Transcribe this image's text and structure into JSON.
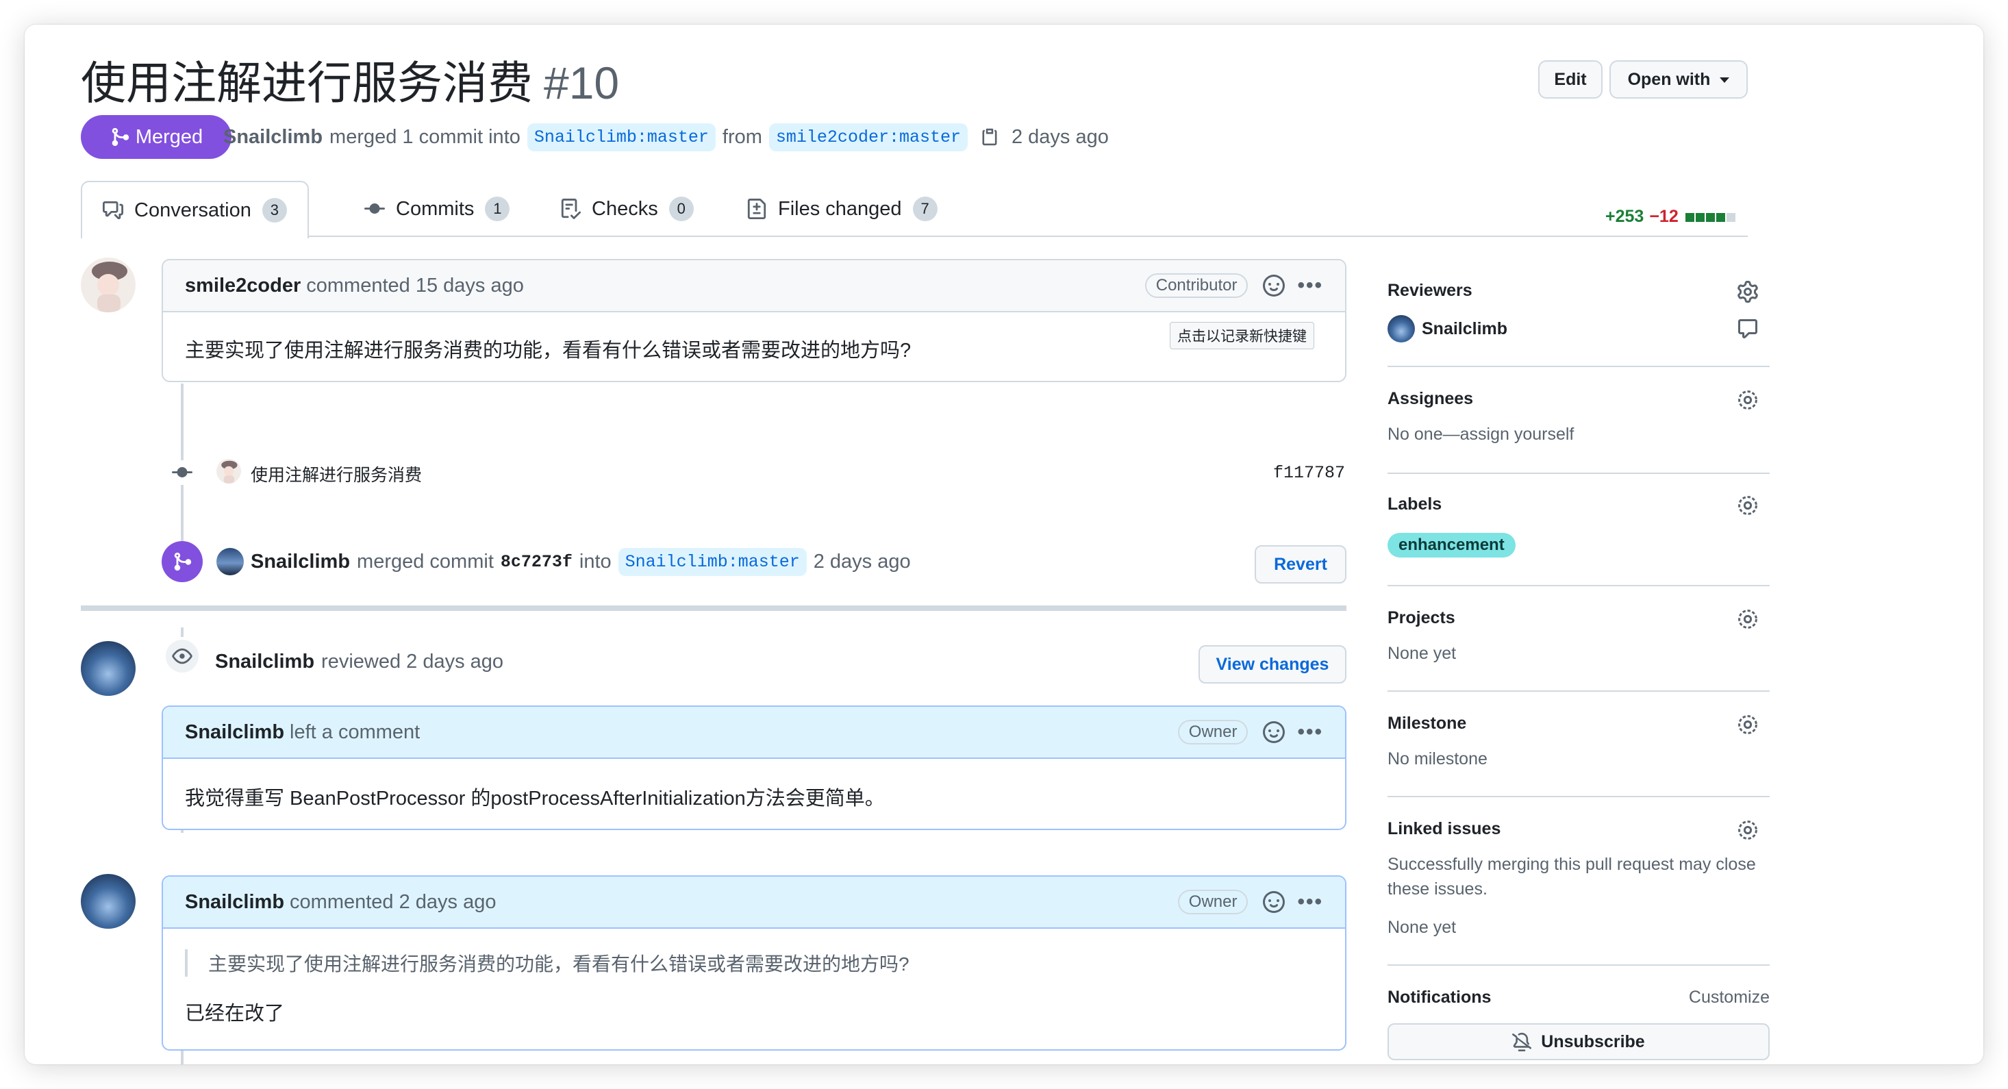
{
  "header": {
    "title": "使用注解进行服务消费",
    "number": "#10",
    "edit_label": "Edit",
    "open_with_label": "Open with"
  },
  "status": {
    "badge": "Merged",
    "author": "Snailclimb",
    "action": "merged 1 commit into",
    "base_branch": "Snailclimb:master",
    "from_word": "from",
    "head_branch": "smile2coder:master",
    "time": "2 days ago"
  },
  "tabs": [
    {
      "label": "Conversation",
      "count": "3"
    },
    {
      "label": "Commits",
      "count": "1"
    },
    {
      "label": "Checks",
      "count": "0"
    },
    {
      "label": "Files changed",
      "count": "7"
    }
  ],
  "diffstat": {
    "additions": "+253",
    "deletions": "−12",
    "colors": [
      "#1a7f37",
      "#1a7f37",
      "#1a7f37",
      "#1a7f37",
      "#d1d9e0"
    ]
  },
  "timeline": {
    "first_comment": {
      "author": "smile2coder",
      "meta": "commented 15 days ago",
      "role": "Contributor",
      "tooltip": "点击以记录新快捷键",
      "body": "主要实现了使用注解进行服务消费的功能，看看有什么错误或者需要改进的地方吗?"
    },
    "commit": {
      "message": "使用注解进行服务消费",
      "sha": "f117787"
    },
    "merge_event": {
      "author": "Snailclimb",
      "text1": "merged commit",
      "sha": "8c7273f",
      "text2": "into",
      "branch": "Snailclimb:master",
      "time": "2 days ago",
      "revert_label": "Revert"
    },
    "review": {
      "author": "Snailclimb",
      "meta": "reviewed 2 days ago",
      "view_changes_label": "View changes",
      "comment_author": "Snailclimb",
      "comment_meta": "left a comment",
      "role": "Owner",
      "body": "我觉得重写 BeanPostProcessor 的postProcessAfterInitialization方法会更简单。"
    },
    "last_comment": {
      "author": "Snailclimb",
      "meta": "commented 2 days ago",
      "role": "Owner",
      "quote": "主要实现了使用注解进行服务消费的功能，看看有什么错误或者需要改进的地方吗?",
      "body": "已经在改了"
    }
  },
  "sidebar": {
    "reviewers": {
      "heading": "Reviewers",
      "name": "Snailclimb"
    },
    "assignees": {
      "heading": "Assignees",
      "value": "No one—assign yourself"
    },
    "labels": {
      "heading": "Labels",
      "chip": "enhancement",
      "chip_color": "#7de3e3"
    },
    "projects": {
      "heading": "Projects",
      "value": "None yet"
    },
    "milestone": {
      "heading": "Milestone",
      "value": "No milestone"
    },
    "linked_issues": {
      "heading": "Linked issues",
      "line1": "Successfully merging this pull request may close",
      "line2": "these issues.",
      "value": "None yet"
    },
    "notifications": {
      "heading": "Notifications",
      "customize": "Customize",
      "unsubscribe": "Unsubscribe"
    }
  },
  "colors": {
    "merged": "#8250df",
    "link": "#0969da",
    "border": "#d1d9e0"
  }
}
